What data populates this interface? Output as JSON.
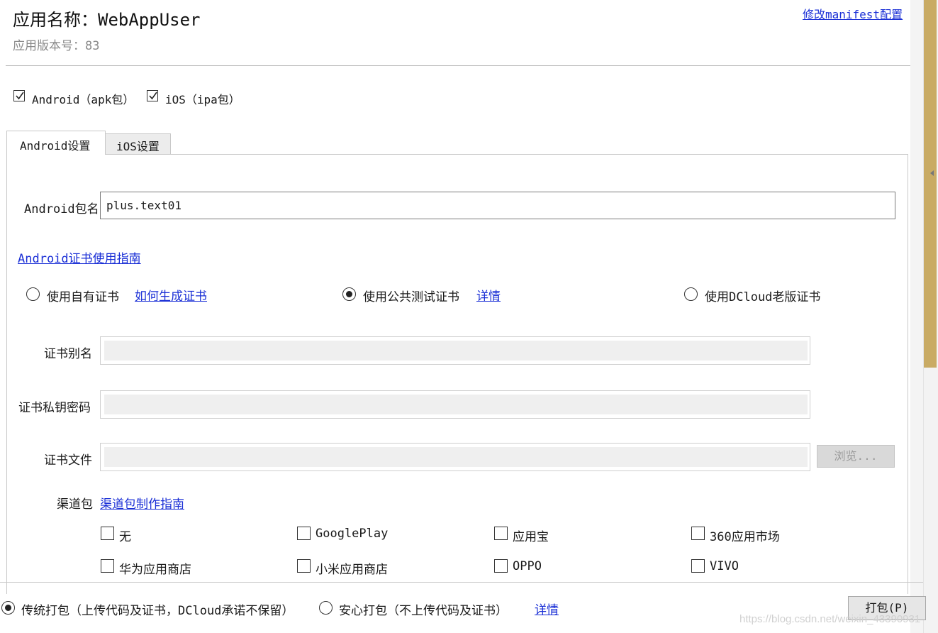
{
  "header": {
    "app_name": "应用名称：WebAppUser",
    "app_version": "应用版本号：83",
    "manifest_link": "修改manifest配置"
  },
  "platforms": [
    {
      "label": "Android（apk包）",
      "checked": true
    },
    {
      "label": "iOS（ipa包）",
      "checked": true
    }
  ],
  "tabs": [
    {
      "label": "Android设置",
      "active": true
    },
    {
      "label": "iOS设置",
      "active": false
    }
  ],
  "android": {
    "package_label": "Android包名",
    "package_value": "plus.text01",
    "cert_guide_link": "Android证书使用指南",
    "cert_options": [
      {
        "label": "使用自有证书",
        "link": "如何生成证书",
        "selected": false
      },
      {
        "label": "使用公共测试证书",
        "link": "详情",
        "selected": true
      },
      {
        "label": "使用DCloud老版证书",
        "selected": false
      }
    ],
    "alias_label": "证书别名",
    "password_label": "证书私钥密码",
    "file_label": "证书文件",
    "browse_label": "浏览...",
    "channel_label": "渠道包",
    "channel_guide_link": "渠道包制作指南",
    "channels": [
      {
        "label": "无",
        "checked": false
      },
      {
        "label": "GooglePlay",
        "checked": false
      },
      {
        "label": "应用宝",
        "checked": false
      },
      {
        "label": "360应用市场",
        "checked": false
      },
      {
        "label": "华为应用商店",
        "checked": false
      },
      {
        "label": "小米应用商店",
        "checked": false
      },
      {
        "label": "OPPO",
        "checked": false
      },
      {
        "label": "VIVO",
        "checked": false
      }
    ]
  },
  "footer": {
    "pack_modes": [
      {
        "label": "传统打包（上传代码及证书，DCloud承诺不保留）",
        "selected": true
      },
      {
        "label": "安心打包（不上传代码及证书）",
        "selected": false
      }
    ],
    "details_link": "详情",
    "pack_button": "打包(P)",
    "watermark": "https://blog.csdn.net/weixin_43390931"
  },
  "colors": {
    "link": "#1a2fd6",
    "scrollbar_thumb": "#c9ab64",
    "disabled_fill": "#efefef"
  }
}
